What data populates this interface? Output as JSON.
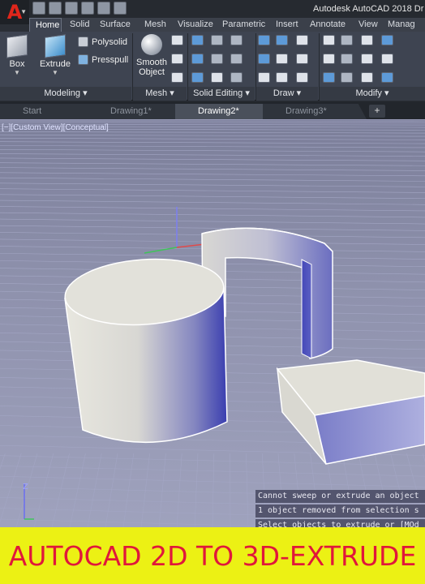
{
  "app": {
    "icon_letter": "A",
    "title": "Autodesk AutoCAD 2018   Dr"
  },
  "quick_access": [
    "new-icon",
    "open-icon",
    "save-icon",
    "saveas-icon",
    "plot-icon",
    "undo-icon"
  ],
  "ribbon_tabs": [
    "Home",
    "Solid",
    "Surface",
    "Mesh",
    "Visualize",
    "Parametric",
    "Insert",
    "Annotate",
    "View",
    "Manag"
  ],
  "active_tab": "Home",
  "ribbon": {
    "box_label": "Box",
    "extrude_label": "Extrude",
    "polysolid_label": "Polysolid",
    "presspull_label": "Presspull",
    "smooth_object_label_1": "Smooth",
    "smooth_object_label_2": "Object",
    "panels": {
      "modeling": "Modeling",
      "mesh": "Mesh",
      "solid_editing": "Solid Editing",
      "draw": "Draw",
      "modify": "Modify"
    }
  },
  "file_tabs": [
    "Start",
    "Drawing1*",
    "Drawing2*",
    "Drawing3*"
  ],
  "active_file_tab": "Drawing2*",
  "viewport": {
    "label": "[−][Custom View][Conceptual]"
  },
  "command_history": [
    "Cannot sweep or extrude an object",
    "1 object removed from selection s",
    "Select objects to extrude or [MOd"
  ],
  "caption": "AUTOCAD 2D TO 3D-EXTRUDE",
  "colors": {
    "caption_bg": "#ECF114",
    "caption_text": "#E0173B",
    "app_red": "#E0261B",
    "viewport_bg": "#8E91AC"
  }
}
